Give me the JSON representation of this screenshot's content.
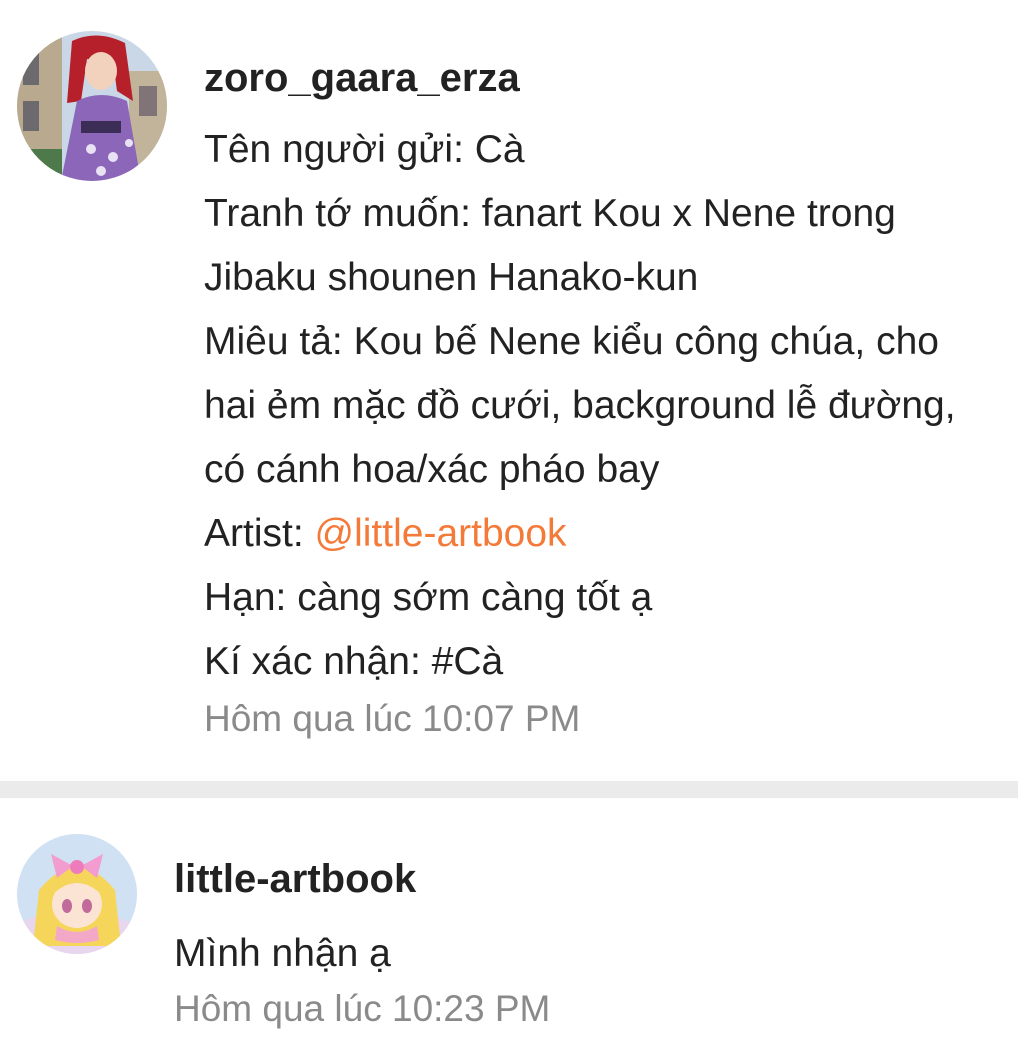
{
  "comments": [
    {
      "username": "zoro_gaara_erza",
      "avatar": "erza-scarlet-avatar",
      "lines": {
        "l1": "Tên người gửi: Cà",
        "l2": "Tranh tớ muốn: fanart Kou x Nene trong",
        "l3": "Jibaku shounen Hanako-kun",
        "l4": "Miêu tả: Kou bế Nene kiểu công chúa, cho",
        "l5": "hai ẻm mặc đồ cưới, background lễ đường,",
        "l6": "có cánh hoa/xác pháo bay",
        "l7_prefix": "Artist: ",
        "l7_mention": "@little-artbook",
        "l8": "Hạn: càng sớm càng tốt ạ",
        "l9": "Kí xác nhận: #Cà"
      },
      "timestamp": "Hôm qua lúc 10:07 PM"
    },
    {
      "username": "little-artbook",
      "avatar": "anime-girl-pink-bow-avatar",
      "text": "Mình nhận ạ",
      "timestamp": "Hôm qua lúc 10:23 PM"
    }
  ],
  "colors": {
    "text": "#222222",
    "mention": "#f47a3a",
    "timestamp": "#8a8a8a",
    "divider": "#ebebeb"
  }
}
